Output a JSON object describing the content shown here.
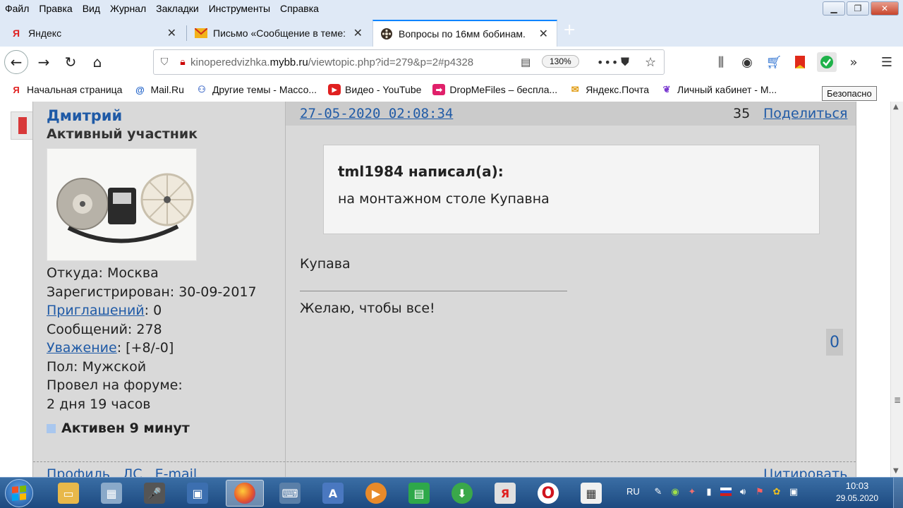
{
  "menubar": {
    "items": [
      {
        "label": "Файл"
      },
      {
        "label": "Правка"
      },
      {
        "label": "Вид"
      },
      {
        "label": "Журнал"
      },
      {
        "label": "Закладки"
      },
      {
        "label": "Инструменты"
      },
      {
        "label": "Справка"
      }
    ]
  },
  "tabs": [
    {
      "label": "Яндекс",
      "icon": "yandex-icon",
      "favicon_text": "Я"
    },
    {
      "label": "Письмо «Сообщение в теме:",
      "icon": "mail-icon"
    },
    {
      "label": "Вопросы по 16мм бобинам.",
      "icon": "film-reel-icon",
      "active": true
    }
  ],
  "navbar": {
    "url_host_prefix": "kinoperedvizhka.",
    "url_host_main": "mybb.ru",
    "url_path": "/viewtopic.php?id=279&p=2#p4328",
    "zoom": "130%"
  },
  "bookmarks": [
    {
      "label": "Начальная страница",
      "icon": "yandex-icon",
      "glyph": "Я"
    },
    {
      "label": "Mail.Ru",
      "icon": "mailru-icon",
      "glyph": "@"
    },
    {
      "label": "Другие темы - Массо...",
      "icon": "people-icon",
      "glyph": "⚇"
    },
    {
      "label": "Видео - YouTube",
      "icon": "youtube-icon",
      "glyph": "▶"
    },
    {
      "label": "DropMeFiles – бесплa...",
      "icon": "dropmefiles-icon",
      "glyph": "➡"
    },
    {
      "label": "Яндекс.Почта",
      "icon": "mail-icon",
      "glyph": "✉"
    },
    {
      "label": "Личный кабинет - М...",
      "icon": "leaf-icon",
      "glyph": "❦"
    }
  ],
  "tooltip": "Безопасно",
  "post": {
    "author": "Дмитрий",
    "rank": "Активный участник",
    "from_label": "Откуда: Москва",
    "registered": "Зарегистрирован: 30-09-2017",
    "invites_link": "Приглашений",
    "invites_value": ": 0",
    "messages": "Сообщений: 278",
    "respect_link": "Уважение",
    "respect_value": ": [+8/-0]",
    "gender": "Пол: Мужской",
    "time_label": "Провел на форуме:",
    "time_value": "2 дня 19 часов",
    "active": "Активен 9 минут",
    "date": "27-05-2020 02:08:34",
    "number": "35",
    "share": "Поделиться",
    "quote_author": "tml1984 написал(а):",
    "quote_text": "на монтажном столе Купавна",
    "text": "Купава",
    "signature": "Желаю, чтобы все!",
    "rating": "0",
    "footer_profile": "Профиль",
    "footer_pm": "ЛС",
    "footer_email": "E-mail",
    "footer_quote": "Цитировать"
  },
  "taskbar": {
    "lang": "RU",
    "time": "10:03",
    "date": "29.05.2020",
    "apps": [
      {
        "icon": "explorer-icon",
        "color": "#e8b84a",
        "glyph": "▭"
      },
      {
        "icon": "calculator-icon",
        "color": "#8aa9c9",
        "glyph": "▦"
      },
      {
        "icon": "microphone-icon",
        "color": "#555555",
        "glyph": "🎤"
      },
      {
        "icon": "monitor-icon",
        "color": "#3c6fb0",
        "glyph": "▣"
      },
      {
        "icon": "firefox-icon",
        "color": "#e8572a",
        "glyph": "●"
      },
      {
        "icon": "keyboard-icon",
        "color": "#5a7fa8",
        "glyph": "⌨"
      },
      {
        "icon": "wordpad-icon",
        "color": "#4a78c0",
        "glyph": "A"
      },
      {
        "icon": "media-player-icon",
        "color": "#e88a2a",
        "glyph": "▶"
      },
      {
        "icon": "spreadsheet-icon",
        "color": "#2ea84a",
        "glyph": "▤"
      },
      {
        "icon": "download-icon",
        "color": "#3aa84a",
        "glyph": "⬇"
      },
      {
        "icon": "yandex-browser-icon",
        "color": "#e0e0e0",
        "glyph": "Я"
      },
      {
        "icon": "opera-icon",
        "color": "#d0141e",
        "glyph": "O"
      },
      {
        "icon": "calendar-icon",
        "color": "#f0f0f0",
        "glyph": "▦"
      }
    ]
  }
}
